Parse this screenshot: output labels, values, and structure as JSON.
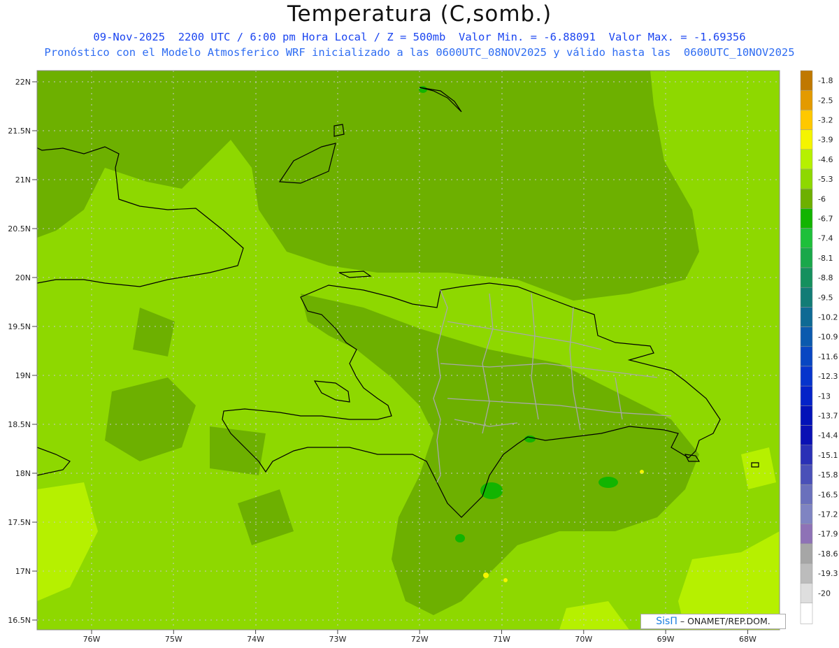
{
  "header": {
    "title": "Temperatura (C,somb.)",
    "line1": "09-Nov-2025  2200 UTC / 6:00 pm Hora Local / Z = 500mb  Valor Min. = -6.88091  Valor Max. = -1.69356",
    "line2": "Pronóstico con el Modelo Atmosferico WRF inicializado a las 0600UTC_08NOV2025 y válido hasta las  0600UTC_10NOV2025"
  },
  "map": {
    "lat_labels": [
      "22N",
      "21.5N",
      "21N",
      "20.5N",
      "20N",
      "19.5N",
      "19N",
      "18.5N",
      "18N",
      "17.5N",
      "17N",
      "16.5N"
    ],
    "lon_labels": [
      "76W",
      "75W",
      "74W",
      "73W",
      "72W",
      "71W",
      "70W",
      "69W",
      "68W"
    ],
    "legend": {
      "labels": [
        "-1.8",
        "-2.5",
        "-3.2",
        "-3.9",
        "-4.6",
        "-5.3",
        "-6",
        "-6.7",
        "-7.4",
        "-8.1",
        "-8.8",
        "-9.5",
        "-10.2",
        "-10.9",
        "-11.6",
        "-12.3",
        "-13",
        "-13.7",
        "-14.4",
        "-15.1",
        "-15.8",
        "-16.5",
        "-17.2",
        "-17.9",
        "-18.6",
        "-19.3",
        "-20"
      ],
      "colors": [
        "#c07800",
        "#e39a00",
        "#ffc800",
        "#f4f400",
        "#b6f000",
        "#8ed800",
        "#6db000",
        "#12b400",
        "#1ec03a",
        "#19a84a",
        "#15905e",
        "#127c76",
        "#0e6a94",
        "#0b5aae",
        "#0846c2",
        "#0634cc",
        "#0422c8",
        "#0312b8",
        "#0a10b4",
        "#2a30b6",
        "#4a50b8",
        "#6a70bc",
        "#7f84c2",
        "#8e72b6",
        "#a6a6a6",
        "#bcbcbc",
        "#dedede"
      ]
    },
    "field_colors": {
      "dominant": "#8ed800",
      "lower": "#6db000",
      "lowest": "#12b400",
      "higher": "#b6f000",
      "warmest": "#f4f400"
    }
  },
  "credit": {
    "brand": "SisΠ",
    "text": " – ONAMET/REP.DOM."
  }
}
